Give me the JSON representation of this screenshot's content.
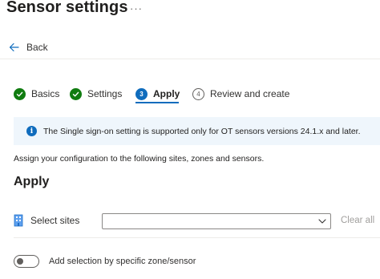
{
  "header": {
    "title": "Sensor settings",
    "more_label": "···"
  },
  "nav": {
    "back_label": "Back"
  },
  "wizard": {
    "steps": [
      {
        "label": "Basics",
        "state": "completed"
      },
      {
        "label": "Settings",
        "state": "completed"
      },
      {
        "number": "3",
        "label": "Apply",
        "state": "current"
      },
      {
        "number": "4",
        "label": "Review and create",
        "state": "pending"
      }
    ]
  },
  "info_bar": {
    "icon": "info-icon",
    "text": "The Single sign-on setting is supported only for OT sensors versions 24.1.x and later."
  },
  "main": {
    "assign_text": "Assign your configuration to the following sites, zones and sensors.",
    "section_title": "Apply",
    "sites": {
      "icon": "building-icon",
      "label": "Select sites",
      "value": "",
      "clear_label": "Clear all"
    },
    "toggle": {
      "label": "Add selection by specific zone/sensor",
      "checked": false
    }
  },
  "colors": {
    "accent": "#0f6cbd",
    "success": "#107c10",
    "info_bg": "#eff6fc"
  }
}
